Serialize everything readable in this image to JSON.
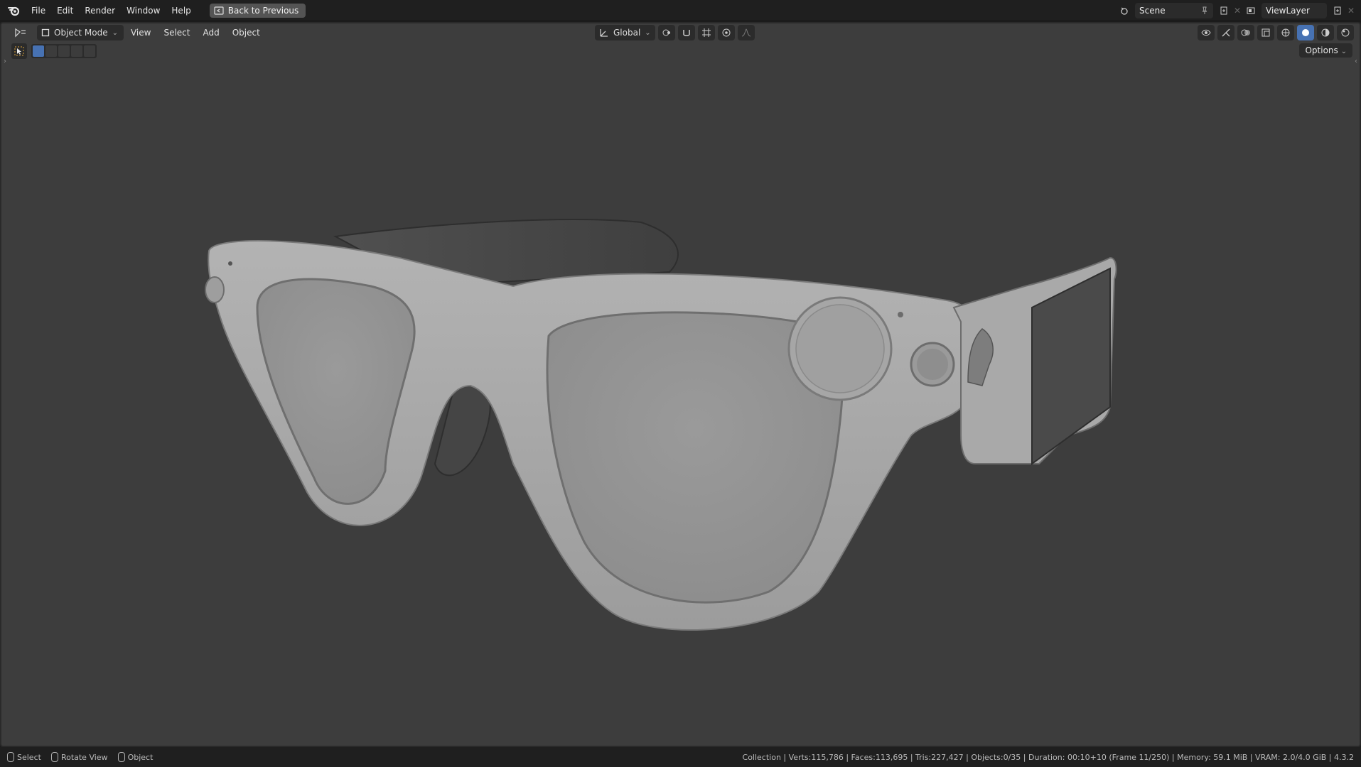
{
  "topbar": {
    "menu": [
      "File",
      "Edit",
      "Render",
      "Window",
      "Help"
    ],
    "back_button": "Back to Previous",
    "scene_name": "Scene",
    "view_layer_name": "ViewLayer",
    "icons": [
      "blender-logo-icon",
      "back-icon",
      "scene-icon",
      "pin-icon",
      "new-scene-icon",
      "view-layer-icon",
      "new-view-layer-icon"
    ]
  },
  "viewport_header": {
    "mode": "Object Mode",
    "menu": [
      "View",
      "Select",
      "Add",
      "Object"
    ],
    "transform_orientation": "Global",
    "options_label": "Options"
  },
  "status": {
    "hints": [
      "Select",
      "Rotate View",
      "Object"
    ],
    "stats": "Collection | Verts:115,786 | Faces:113,695 | Tris:227,427 | Objects:0/35 | Duration: 00:10+10 (Frame 11/250) | Memory: 59.1 MiB | VRAM: 2.0/4.0 GiB | 4.3.2"
  },
  "colors": {
    "viewport_bg": "#3d3d3d",
    "topbar_bg": "#1f1f1f",
    "accent": "#4772b3",
    "model_light": "#a9a9a9",
    "model_dark": "#5b5b5b"
  }
}
